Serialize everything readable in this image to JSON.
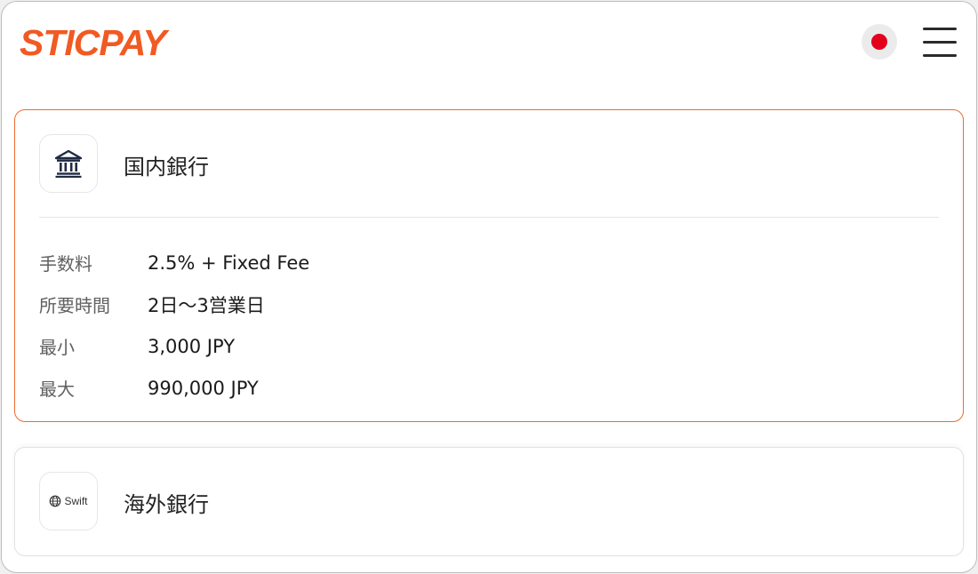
{
  "header": {
    "logo_text": "STICPAY",
    "language_flag": "japan-flag-icon",
    "menu_icon": "hamburger-menu-icon"
  },
  "methods": [
    {
      "title": "国内銀行",
      "icon": "bank-icon",
      "selected": true,
      "details": [
        {
          "label": "手数料",
          "value": "2.5% + Fixed Fee"
        },
        {
          "label": "所要時間",
          "value": "2日～3営業日"
        },
        {
          "label": "最小",
          "value": "3,000 JPY"
        },
        {
          "label": "最大",
          "value": "990,000 JPY"
        }
      ]
    },
    {
      "title": "海外銀行",
      "icon": "swift-globe-icon",
      "icon_text": "Swift",
      "selected": false
    }
  ],
  "colors": {
    "brand": "#f15a22",
    "selected_border": "#ee6a2f",
    "flag_red": "#e3001b"
  }
}
